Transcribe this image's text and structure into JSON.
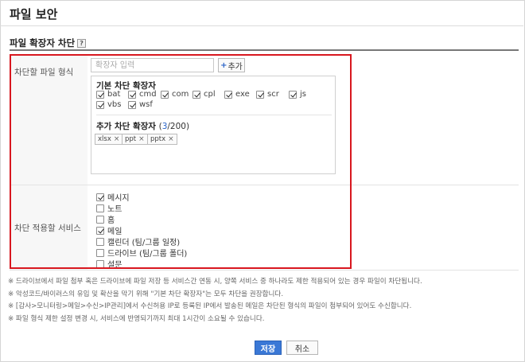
{
  "page": {
    "title": "파일 보안"
  },
  "section": {
    "title": "파일 확장자 차단",
    "help_icon": "?"
  },
  "block_types": {
    "label": "차단할 파일 형식",
    "input_placeholder": "확장자 입력",
    "add_button": "추가",
    "basic": {
      "title": "기본 차단 확장자",
      "items": [
        {
          "label": "bat",
          "checked": true
        },
        {
          "label": "cmd",
          "checked": true
        },
        {
          "label": "com",
          "checked": true
        },
        {
          "label": "cpl",
          "checked": true
        },
        {
          "label": "exe",
          "checked": true
        },
        {
          "label": "scr",
          "checked": true
        },
        {
          "label": "js",
          "checked": true
        },
        {
          "label": "vbs",
          "checked": true
        },
        {
          "label": "wsf",
          "checked": true
        }
      ]
    },
    "custom": {
      "title": "추가 차단 확장자",
      "count_open": "(",
      "count": "3",
      "count_total": "/200)",
      "tags": [
        {
          "label": "xlsx",
          "remove": "×"
        },
        {
          "label": "ppt",
          "remove": "×"
        },
        {
          "label": "pptx",
          "remove": "×"
        }
      ]
    }
  },
  "services": {
    "label": "차단 적용할 서비스",
    "items": [
      {
        "label": "메시지",
        "checked": true
      },
      {
        "label": "노트",
        "checked": false
      },
      {
        "label": "홈",
        "checked": false
      },
      {
        "label": "메일",
        "checked": true
      },
      {
        "label": "캘린더 (팀/그룹 일정)",
        "checked": false
      },
      {
        "label": "드라이브 (팀/그룹 폴더)",
        "checked": false
      },
      {
        "label": "설문",
        "checked": false
      }
    ]
  },
  "notes": [
    "※ 드라이브에서 파일 첨부 혹은 드라이브에 파일 저장 등 서비스간 연동 시, 양쪽 서비스 중 하나라도 제한 적용되어 있는 경우 파일이 차단됩니다.",
    "※ 악성코드/바이러스의 유입 및 확산을 막기 위해 \"기본 차단 확장자\"는 모두 차단을 권장합니다.",
    "※ [감사>모니터링>메일>수신>IP관리]에서 수신허용 IP로 등록된 IP에서 발송된 메일은 차단된 형식의 파일이 첨부되어 있어도 수신합니다.",
    "※ 파일 형식 제한 설정 변경 시, 서비스에 반영되기까지 최대 1시간이 소요될 수 있습니다."
  ],
  "buttons": {
    "save": "저장",
    "cancel": "취소"
  }
}
